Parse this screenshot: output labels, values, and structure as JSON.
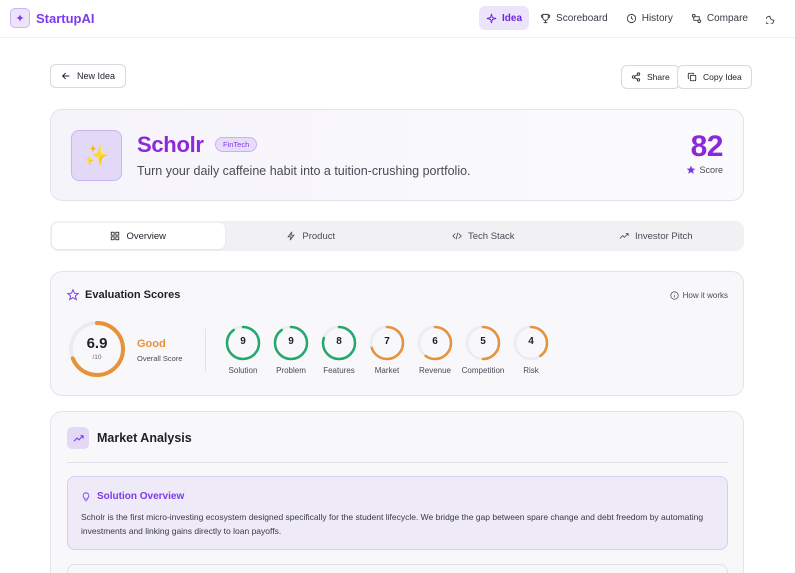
{
  "brand": {
    "name": "StartupAI"
  },
  "nav": {
    "items": [
      {
        "label": "Idea",
        "active": true
      },
      {
        "label": "Scoreboard"
      },
      {
        "label": "History"
      },
      {
        "label": "Compare"
      }
    ]
  },
  "actions": {
    "new_idea": "New Idea",
    "share": "Share",
    "copy_idea": "Copy Idea"
  },
  "hero": {
    "title": "Scholr",
    "badge": "FinTech",
    "tagline": "Turn your daily caffeine habit into a tuition-crushing portfolio.",
    "score": "82",
    "score_label": "Score"
  },
  "tabs": [
    {
      "label": "Overview",
      "icon": "grid-icon",
      "active": true
    },
    {
      "label": "Product",
      "icon": "bolt-icon"
    },
    {
      "label": "Tech Stack",
      "icon": "code-icon"
    },
    {
      "label": "Investor Pitch",
      "icon": "trending-up-icon"
    }
  ],
  "evaluation": {
    "title": "Evaluation Scores",
    "how": "How it works",
    "overall": {
      "value": 6.9,
      "display": "6.9",
      "out_of": "/10",
      "word": "Good",
      "sub": "Overall Score",
      "color": "#e5923a"
    },
    "metrics": [
      {
        "label": "Solution",
        "value": 9,
        "display": "9",
        "color": "#22a86b"
      },
      {
        "label": "Problem",
        "value": 9,
        "display": "9",
        "color": "#22a86b"
      },
      {
        "label": "Features",
        "value": 8,
        "display": "8",
        "color": "#22a86b"
      },
      {
        "label": "Market",
        "value": 7,
        "display": "7",
        "color": "#e5923a"
      },
      {
        "label": "Revenue",
        "value": 6,
        "display": "6",
        "color": "#e5923a"
      },
      {
        "label": "Competition",
        "value": 5,
        "display": "5",
        "color": "#e5923a"
      },
      {
        "label": "Risk",
        "value": 4,
        "display": "4",
        "color": "#e5923a"
      }
    ]
  },
  "market": {
    "title": "Market Analysis",
    "solution_title": "Solution Overview",
    "solution_text": "Scholr is the first micro-investing ecosystem designed specifically for the student lifecycle. We bridge the gap between spare change and debt freedom by automating investments and linking gains directly to loan payoffs."
  },
  "colors": {
    "accent": "#7c3aed",
    "good": "#22a86b",
    "warn": "#e5923a"
  }
}
